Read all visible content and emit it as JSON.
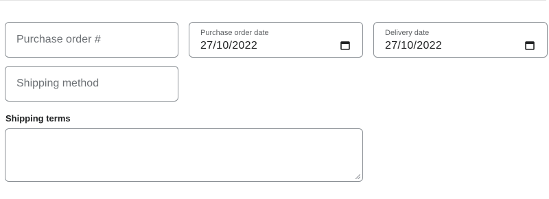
{
  "form": {
    "purchase_order": {
      "placeholder": "Purchase order #",
      "value": ""
    },
    "purchase_order_date": {
      "label": "Purchase order date",
      "value": "27/10/2022",
      "icon": "calendar-icon"
    },
    "delivery_date": {
      "label": "Delivery date",
      "value": "27/10/2022",
      "icon": "calendar-icon"
    },
    "shipping_method": {
      "placeholder": "Shipping method",
      "value": ""
    },
    "shipping_terms": {
      "label": "Shipping terms",
      "value": ""
    }
  }
}
